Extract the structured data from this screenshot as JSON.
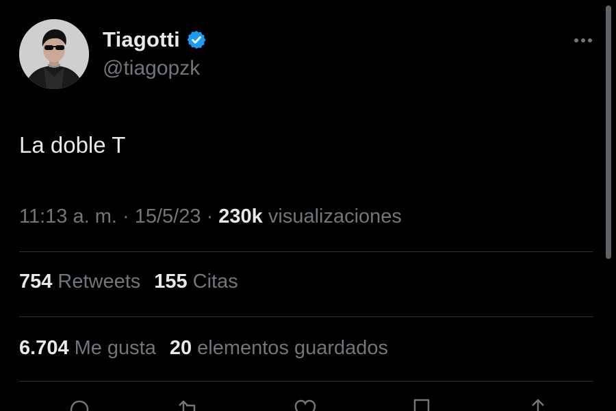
{
  "author": {
    "display_name": "Tiagotti",
    "handle": "@tiagopzk",
    "verified": true,
    "verified_icon": "verified-badge-icon",
    "avatar_icon": "avatar-photo"
  },
  "tweet": {
    "text": "La doble T"
  },
  "meta": {
    "time": "11:13 a. m.",
    "separator": "·",
    "date": "15/5/23",
    "views_count": "230k",
    "views_label": "visualizaciones"
  },
  "stats": {
    "retweets_count": "754",
    "retweets_label": "Retweets",
    "quotes_count": "155",
    "quotes_label": "Citas",
    "likes_count": "6.704",
    "likes_label": "Me gusta",
    "bookmarks_count": "20",
    "bookmarks_label": "elementos guardados"
  },
  "actions": [
    "reply-icon",
    "retweet-icon",
    "like-icon",
    "bookmark-icon",
    "share-icon"
  ],
  "colors": {
    "background": "#000000",
    "text_primary": "#e7e9ea",
    "text_secondary": "#71767b",
    "divider": "#2f3336",
    "verified_blue": "#1d9bf0"
  }
}
